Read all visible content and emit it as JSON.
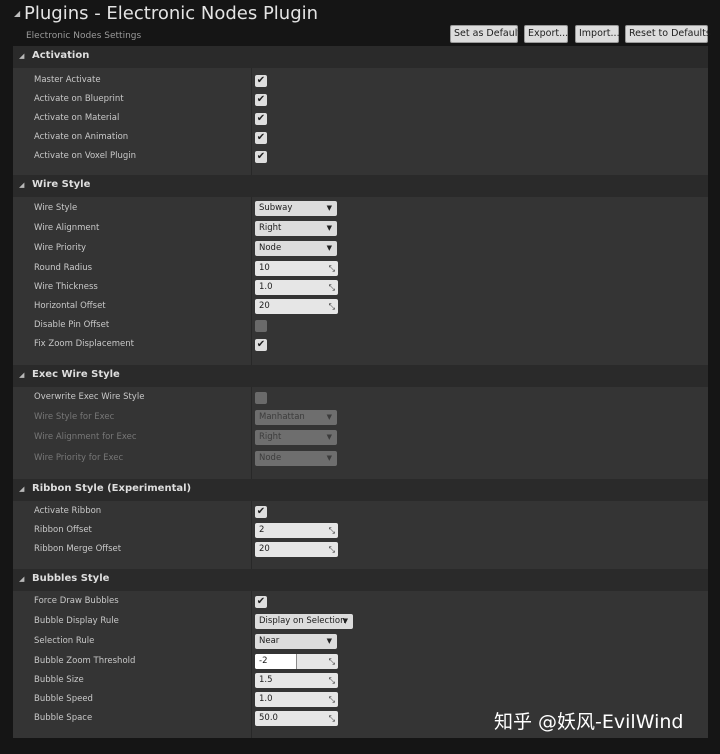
{
  "header": {
    "title": "Plugins - Electronic Nodes Plugin",
    "subtitle": "Electronic Nodes Settings",
    "buttons": {
      "set_default": "Set as Default",
      "export": "Export...",
      "import": "Import...",
      "reset": "Reset to Defaults"
    }
  },
  "sections": {
    "activation": {
      "title": "Activation",
      "master_activate": {
        "label": "Master Activate",
        "checked": true
      },
      "activate_blueprint": {
        "label": "Activate on Blueprint",
        "checked": true
      },
      "activate_material": {
        "label": "Activate on Material",
        "checked": true
      },
      "activate_animation": {
        "label": "Activate on Animation",
        "checked": true
      },
      "activate_voxel": {
        "label": "Activate on Voxel Plugin",
        "checked": true
      }
    },
    "wire_style": {
      "title": "Wire Style",
      "wire_style": {
        "label": "Wire Style",
        "value": "Subway"
      },
      "wire_alignment": {
        "label": "Wire Alignment",
        "value": "Right"
      },
      "wire_priority": {
        "label": "Wire Priority",
        "value": "Node"
      },
      "round_radius": {
        "label": "Round Radius",
        "value": "10"
      },
      "wire_thickness": {
        "label": "Wire Thickness",
        "value": "1.0"
      },
      "horizontal_offset": {
        "label": "Horizontal Offset",
        "value": "20"
      },
      "disable_pin_offset": {
        "label": "Disable Pin Offset",
        "checked": false
      },
      "fix_zoom": {
        "label": "Fix Zoom Displacement",
        "checked": true
      }
    },
    "exec_wire_style": {
      "title": "Exec Wire Style",
      "overwrite": {
        "label": "Overwrite Exec Wire Style",
        "checked": false
      },
      "style_exec": {
        "label": "Wire Style for Exec",
        "value": "Manhattan"
      },
      "alignment_exec": {
        "label": "Wire Alignment for Exec",
        "value": "Right"
      },
      "priority_exec": {
        "label": "Wire Priority for Exec",
        "value": "Node"
      }
    },
    "ribbon_style": {
      "title": "Ribbon Style (Experimental)",
      "activate_ribbon": {
        "label": "Activate Ribbon",
        "checked": true
      },
      "ribbon_offset": {
        "label": "Ribbon Offset",
        "value": "2"
      },
      "ribbon_merge_offset": {
        "label": "Ribbon Merge Offset",
        "value": "20"
      }
    },
    "bubbles_style": {
      "title": "Bubbles Style",
      "force_draw": {
        "label": "Force Draw Bubbles",
        "checked": true
      },
      "display_rule": {
        "label": "Bubble Display Rule",
        "value": "Display on Selection"
      },
      "selection_rule": {
        "label": "Selection Rule",
        "value": "Near"
      },
      "zoom_threshold": {
        "label": "Bubble Zoom Threshold",
        "value": "-2",
        "slider_fraction": 0.5
      },
      "bubble_size": {
        "label": "Bubble Size",
        "value": "1.5"
      },
      "bubble_speed": {
        "label": "Bubble Speed",
        "value": "1.0"
      },
      "bubble_space": {
        "label": "Bubble Space",
        "value": "50.0"
      }
    }
  },
  "watermark": "知乎 @妖风-EvilWind",
  "icons": {
    "checkbox": "checkmark-icon",
    "dropdown": "dropdown-arrow-icon",
    "numeric": "drag-resize-icon",
    "collapse": "collapse-triangle-icon"
  }
}
